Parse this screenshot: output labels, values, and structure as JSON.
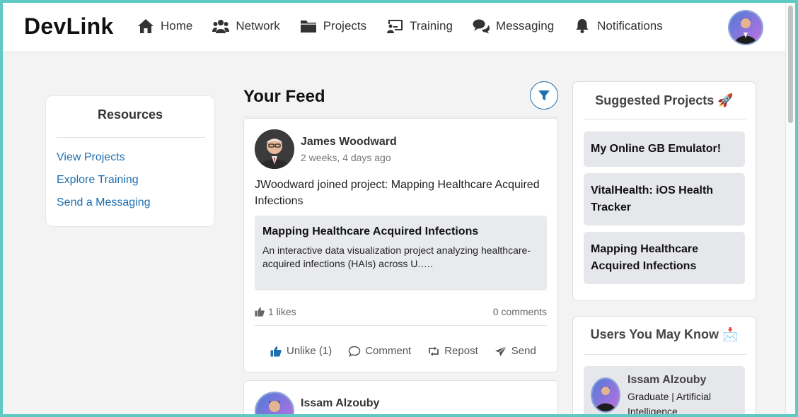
{
  "header": {
    "logo": "DevLink",
    "nav": [
      {
        "label": "Home",
        "icon": "home-icon"
      },
      {
        "label": "Network",
        "icon": "users-icon"
      },
      {
        "label": "Projects",
        "icon": "folder-icon"
      },
      {
        "label": "Training",
        "icon": "presentation-icon"
      },
      {
        "label": "Messaging",
        "icon": "chat-icon"
      },
      {
        "label": "Notifications",
        "icon": "bell-icon"
      }
    ]
  },
  "resources": {
    "title": "Resources",
    "links": [
      "View Projects",
      "Explore Training",
      "Send a Messaging"
    ]
  },
  "feed": {
    "title": "Your Feed",
    "posts": [
      {
        "author": "James Woodward",
        "time": "2 weeks, 4 days ago",
        "text": "JWoodward joined project: Mapping Healthcare Acquired Infections",
        "project_title": "Mapping Healthcare Acquired Infections",
        "project_desc": "An interactive data visualization project analyzing healthcare-acquired infections (HAIs) across U.….",
        "likes": "1 likes",
        "comments": "0 comments",
        "actions": {
          "unlike": "Unlike (1)",
          "comment": "Comment",
          "repost": "Repost",
          "send": "Send"
        }
      },
      {
        "author": "Issam Alzouby"
      }
    ]
  },
  "suggested": {
    "title": "Suggested Projects 🚀",
    "items": [
      "My Online GB Emulator!",
      "VitalHealth: iOS Health Tracker",
      "Mapping Healthcare Acquired Infections"
    ]
  },
  "people": {
    "title": "Users You May Know 📩",
    "users": [
      {
        "name": "Issam Alzouby",
        "bio": "Graduate | Artificial Intelligence"
      }
    ]
  },
  "colors": {
    "accent": "#1f6fb0",
    "frame": "#5fc9c4",
    "background": "#f3f3f3",
    "card_gray": "#e6e7eb"
  }
}
